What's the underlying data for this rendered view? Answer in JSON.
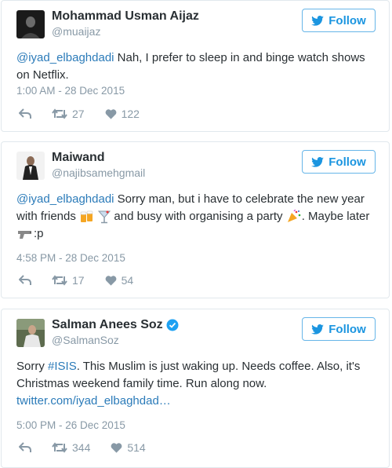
{
  "tweets": [
    {
      "name": "Mohammad Usman Aijaz",
      "handle": "@muaijaz",
      "follow_label": "Follow",
      "mention": "@iyad_elbaghdadi",
      "text": " Nah, I prefer to sleep in and binge watch shows on Netflix.",
      "timestamp": "1:00 AM - 28 Dec 2015",
      "retweets": "27",
      "likes": "122"
    },
    {
      "name": "Maiwand",
      "handle": "@najibsamehgmail",
      "follow_label": "Follow",
      "mention": "@iyad_elbaghdadi",
      "text_a": " Sorry man, but i have to celebrate the new year with friends ",
      "text_b": " and busy with organising a party ",
      "text_c": ". Maybe later ",
      "text_d": ":p",
      "timestamp": "4:58 PM - 28 Dec 2015",
      "retweets": "17",
      "likes": "54"
    },
    {
      "name": "Salman Anees Soz",
      "handle": "@SalmanSoz",
      "follow_label": "Follow",
      "text_a": "Sorry ",
      "hashtag": "#ISIS",
      "text_b": ". This Muslim is just waking up. Needs coffee. Also, it's Christmas weekend family time. Run along now.",
      "link": "twitter.com/iyad_elbaghdad…",
      "timestamp": "5:00 PM - 26 Dec 2015",
      "retweets": "344",
      "likes": "514"
    }
  ],
  "icons": {
    "reply": "reply-icon",
    "retweet": "retweet-icon",
    "like": "heart-icon",
    "follow": "twitter-bird-icon",
    "verified": "verified-badge-icon"
  },
  "colors": {
    "accent": "#1b95e0",
    "link": "#2b7bb9",
    "muted": "#8899a6",
    "verified": "#1da1f2"
  }
}
